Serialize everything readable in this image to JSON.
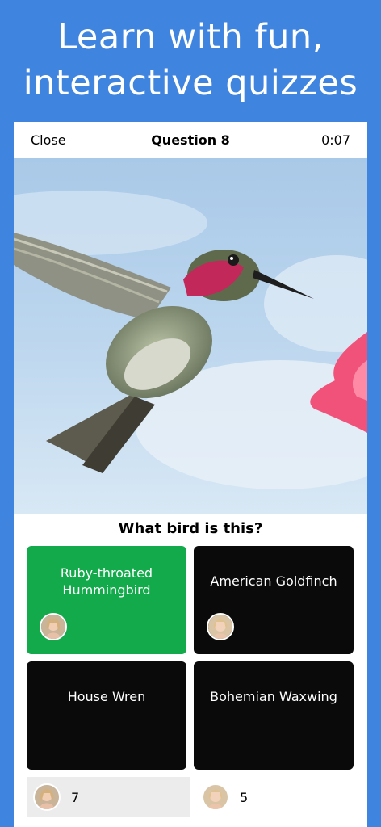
{
  "headline": {
    "line1": "Learn with fun,",
    "line2": "interactive quizzes"
  },
  "quiz": {
    "close_label": "Close",
    "title": "Question 8",
    "timer": "0:07",
    "question": "What bird is this?",
    "answers": [
      {
        "label_line1": "Ruby-throated",
        "label_line2": "Hummingbird",
        "state": "correct"
      },
      {
        "label": "American Goldfinch"
      },
      {
        "label": "House Wren"
      },
      {
        "label": "Bohemian Waxwing"
      }
    ]
  },
  "scores": {
    "player": "7",
    "opponent": "5"
  },
  "colors": {
    "background": "#3f85e0",
    "correct": "#12aa4a",
    "answer_default": "#0a0a0a"
  }
}
